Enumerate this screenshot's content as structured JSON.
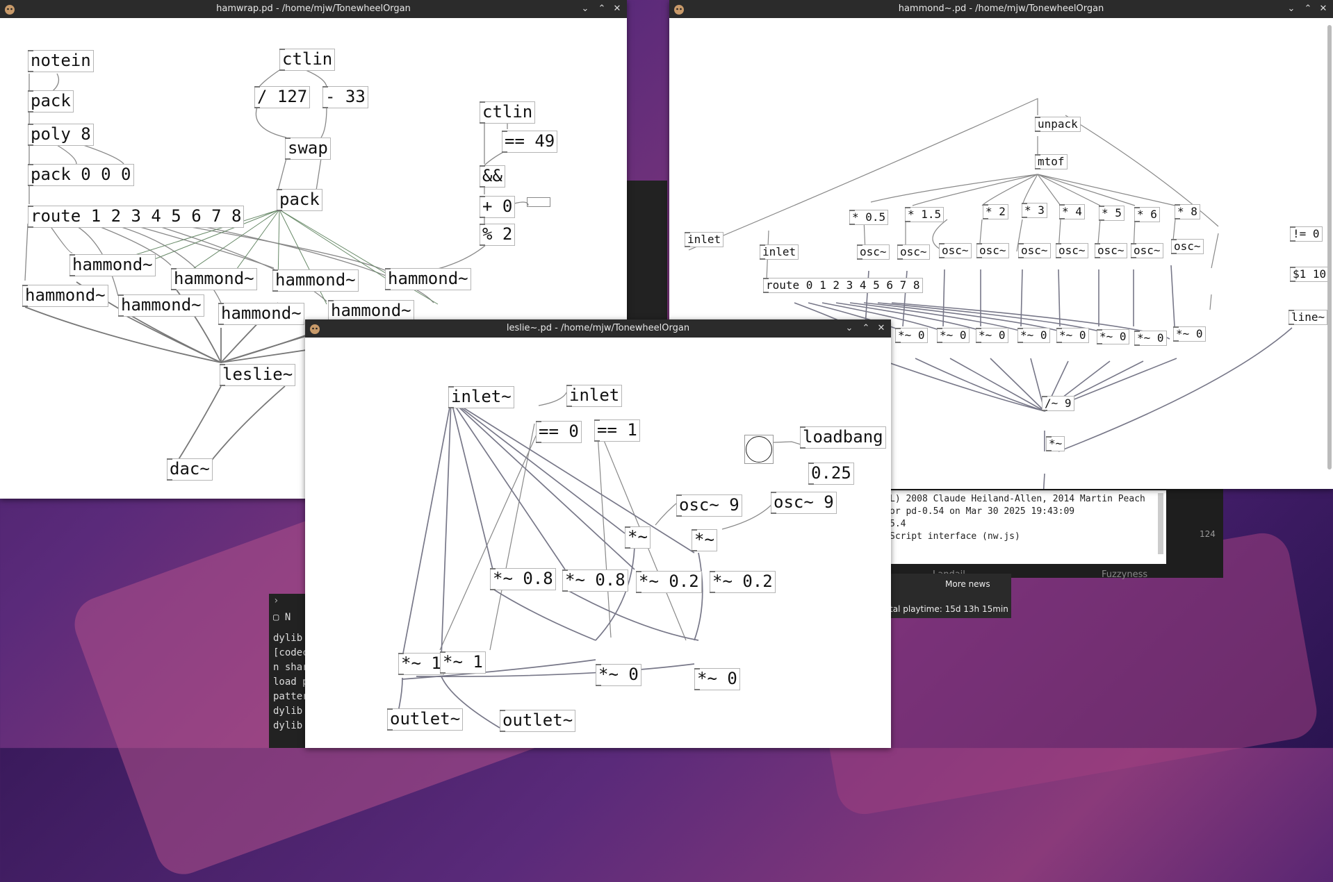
{
  "windows": {
    "hamwrap": {
      "title": "hamwrap.pd - /home/mjw/TonewheelOrgan"
    },
    "hammond": {
      "title": "hammond~.pd - /home/mjw/TonewheelOrgan"
    },
    "leslie": {
      "title": "leslie~.pd - /home/mjw/TonewheelOrgan"
    }
  },
  "hamwrap_objects": {
    "notein": "notein",
    "pack1": "pack",
    "poly": "poly 8",
    "pack000": "pack 0 0 0",
    "route": "route 1 2 3 4 5 6 7 8",
    "ctlin1": "ctlin",
    "div127": "/ 127",
    "sub33": "- 33",
    "swap": "swap",
    "pack2": "pack",
    "ctlin2": "ctlin",
    "eq49": "== 49",
    "and": "&&",
    "plus0": "+ 0",
    "mod2": "% 2",
    "h1": "hammond~",
    "h2": "hammond~",
    "h3": "hammond~",
    "h4": "hammond~",
    "h5": "hammond~",
    "h6": "hammond~",
    "h7": "hammond~",
    "h8": "hammond~",
    "leslie": "leslie~",
    "dac": "dac~"
  },
  "hammond_objects": {
    "unpack": "unpack",
    "mtof": "mtof",
    "inlet1": "inlet",
    "inlet2": "inlet",
    "m05": "* 0.5",
    "m15": "* 1.5",
    "m2": "* 2",
    "m3": "* 3",
    "m4": "* 4",
    "m5": "* 5",
    "m6": "* 6",
    "m8": "* 8",
    "neq0": "!= 0",
    "msg110": "$1 10",
    "line": "line~",
    "osc": "osc~",
    "route": "route 0 1 2 3 4 5 6 7 8",
    "mul0": "*~ 0",
    "div9": "/~ 9",
    "mulout": "*~"
  },
  "leslie_objects": {
    "inletsig": "inlet~",
    "inlet": "inlet",
    "eq0": "== 0",
    "eq1": "== 1",
    "loadbang": "loadbang",
    "val025": "0.25",
    "osc9a": "osc~ 9",
    "osc9b": "osc~ 9",
    "mulA": "*~",
    "mulB": "*~",
    "m08a": "*~ 0.8",
    "m08b": "*~ 0.8",
    "m02a": "*~ 0.2",
    "m02b": "*~ 0.2",
    "m1a": "*~ 1",
    "m1b": "*~ 1",
    "m0a": "*~ 0",
    "m0b": "*~ 0",
    "outlet1": "outlet~",
    "outlet2": "outlet~"
  },
  "console": {
    "lines": [
      "L) 2008 Claude Heiland-Allen, 2014 Martin Peach",
      "",
      "or pd-0.54 on Mar 30 2025 19:43:09",
      " 5.4",
      "Script interface (nw.js)"
    ]
  },
  "background_app": {
    "landail": "Landail",
    "fuzzyness": "Fuzzyness",
    "more_news": "More news",
    "playtime": "tal playtime: 15d 13h 15min",
    "count": "124"
  },
  "terminal": {
    "lines": [
      "dylib",
      "[codec",
      "n shar",
      "load p",
      "patter",
      "dylib",
      "dylib"
    ],
    "tab_label": "N"
  }
}
